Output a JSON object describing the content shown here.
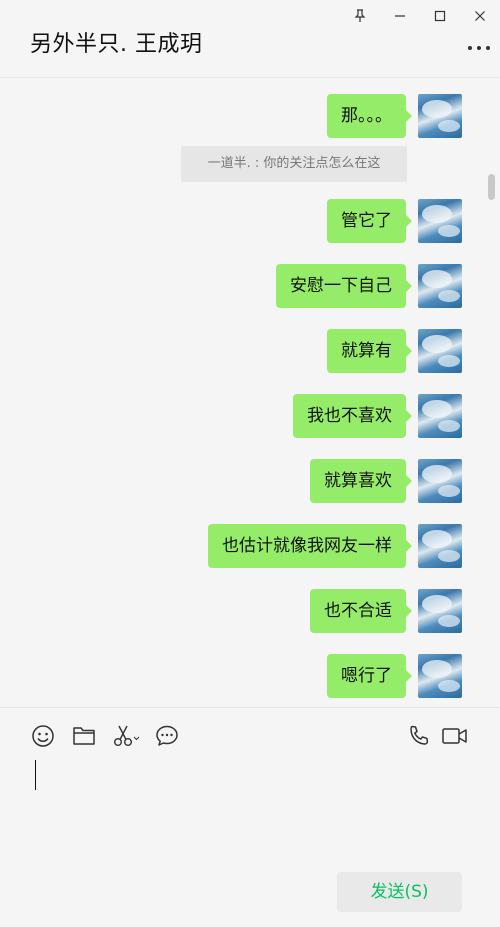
{
  "window": {
    "title": "另外半只. 王成玥"
  },
  "chat": {
    "messages": [
      {
        "text": "那。。。"
      },
      {
        "text": "管它了"
      },
      {
        "text": "安慰一下自己"
      },
      {
        "text": "就算有"
      },
      {
        "text": "我也不喜欢"
      },
      {
        "text": "就算喜欢"
      },
      {
        "text": "也估计就像我网友一样"
      },
      {
        "text": "也不合适"
      },
      {
        "text": "嗯行了"
      }
    ],
    "system_message": "一道半. : 你的关注点怎么在这"
  },
  "toolbar": {
    "icons": [
      "emoji-icon",
      "folder-icon",
      "scissors-icon",
      "chat-bubble-icon",
      "phone-icon",
      "video-icon"
    ]
  },
  "send": {
    "label": "发送(S)"
  },
  "colors": {
    "bubble": "#95ec69",
    "send_text": "#07c160",
    "background": "#f5f5f5"
  }
}
